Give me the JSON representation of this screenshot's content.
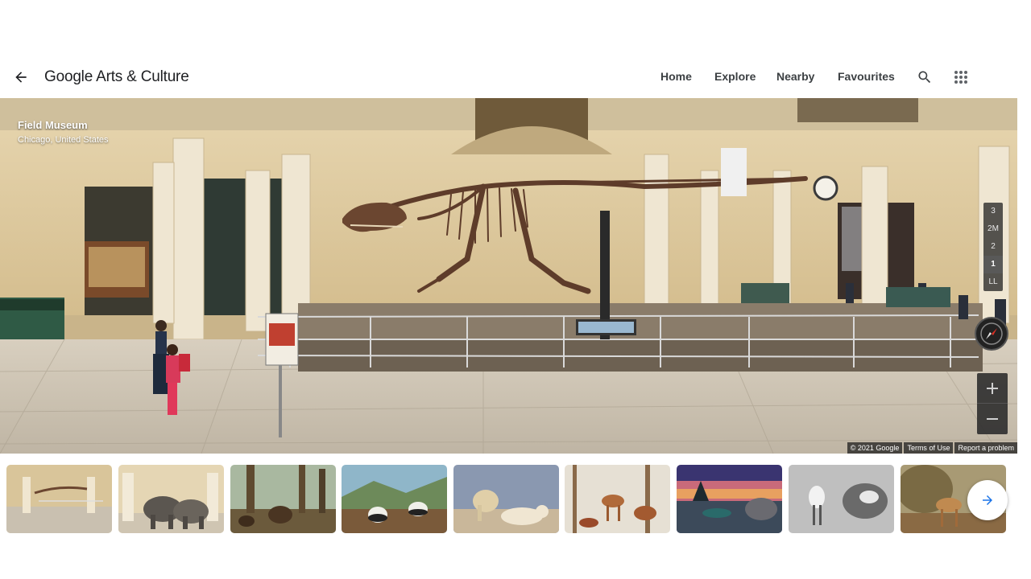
{
  "header": {
    "back_icon": "arrow-left-icon",
    "logo": "Google Arts & Culture",
    "nav": [
      "Home",
      "Explore",
      "Nearby",
      "Favourites"
    ],
    "search_icon": "search-icon",
    "apps_icon": "apps-grid-icon"
  },
  "viewer": {
    "venue_name": "Field Museum",
    "venue_location": "Chicago, United States",
    "floors": [
      "3",
      "2M",
      "2",
      "1",
      "LL"
    ],
    "active_floor": "1",
    "attribution": [
      "© 2021 Google",
      "Terms of Use",
      "Report a problem"
    ],
    "compass_icon": "compass-icon",
    "zoom_in_icon": "plus-icon",
    "zoom_out_icon": "minus-icon"
  },
  "thumbnails": [
    {
      "name": "thumb-main-hall"
    },
    {
      "name": "thumb-elephants"
    },
    {
      "name": "thumb-forest-bears"
    },
    {
      "name": "thumb-pandas"
    },
    {
      "name": "thumb-lions"
    },
    {
      "name": "thumb-deer-forest"
    },
    {
      "name": "thumb-sunset-diorama"
    },
    {
      "name": "thumb-black-white-deer"
    },
    {
      "name": "thumb-deer-bushes"
    }
  ],
  "next_icon": "arrow-right-icon",
  "colors": {
    "accent": "#1a73e8",
    "text": "#202124"
  }
}
